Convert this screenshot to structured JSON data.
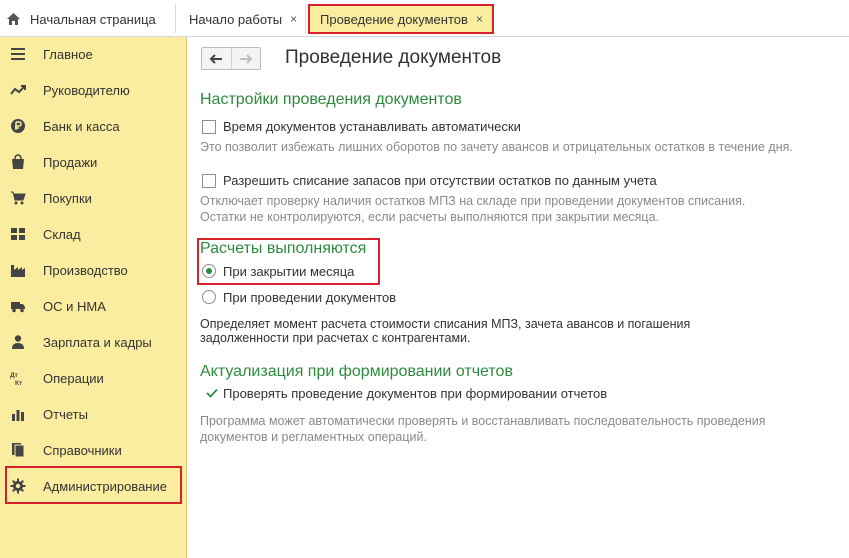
{
  "tabs": {
    "home": "Начальная страница",
    "start": "Начало работы",
    "active": "Проведение документов",
    "close_glyph": "×"
  },
  "sidebar": {
    "items": [
      {
        "label": "Главное",
        "icon": "menu-lines-icon"
      },
      {
        "label": "Руководителю",
        "icon": "trend-icon"
      },
      {
        "label": "Банк и касса",
        "icon": "ruble-coin-icon"
      },
      {
        "label": "Продажи",
        "icon": "shopping-bag-icon"
      },
      {
        "label": "Покупки",
        "icon": "cart-icon"
      },
      {
        "label": "Склад",
        "icon": "warehouse-grid-icon"
      },
      {
        "label": "Производство",
        "icon": "factory-icon"
      },
      {
        "label": "ОС и НМА",
        "icon": "truck-icon"
      },
      {
        "label": "Зарплата и кадры",
        "icon": "person-icon"
      },
      {
        "label": "Операции",
        "icon": "dt-kt-icon"
      },
      {
        "label": "Отчеты",
        "icon": "bar-chart-icon"
      },
      {
        "label": "Справочники",
        "icon": "books-icon"
      },
      {
        "label": "Администрирование",
        "icon": "gear-icon"
      }
    ],
    "dtkt_glyph_top": "Дт",
    "dtkt_glyph_bottom": "Кт"
  },
  "main": {
    "title": "Проведение документов",
    "section1": {
      "title": "Настройки проведения документов",
      "option1": {
        "label": "Время документов устанавливать автоматически",
        "checked": false,
        "hint": "Это позволит избежать лишних оборотов по зачету авансов и отрицательных остатков в течение дня."
      },
      "option2": {
        "label": "Разрешить списание запасов при отсутствии остатков по данным учета",
        "checked": false,
        "hint_line1": "Отключает проверку наличия остатков МПЗ на складе при проведении документов списания.",
        "hint_line2": "Остатки не контролируются, если расчеты выполняются при закрытии месяца."
      }
    },
    "section2": {
      "title": "Расчеты выполняются",
      "radio1": "При закрытии месяца",
      "radio2": "При проведении документов",
      "selected": "При закрытии месяца",
      "note_line1": "Определяет момент расчета стоимости списания МПЗ, зачета авансов и погашения",
      "note_line2": "задолженности при расчетах с контрагентами."
    },
    "section3": {
      "title": "Актуализация при формировании отчетов",
      "check_label": "Проверять проведение документов при формировании отчетов",
      "checked": true,
      "hint_line1": "Программа может автоматически проверять и восстанавливать последовательность проведения",
      "hint_line2": "документов и регламентных операций."
    }
  },
  "colors": {
    "sidebar_bg": "#fbeda0",
    "accent_green": "#2e8b3e",
    "highlight_red": "#d6212a"
  }
}
